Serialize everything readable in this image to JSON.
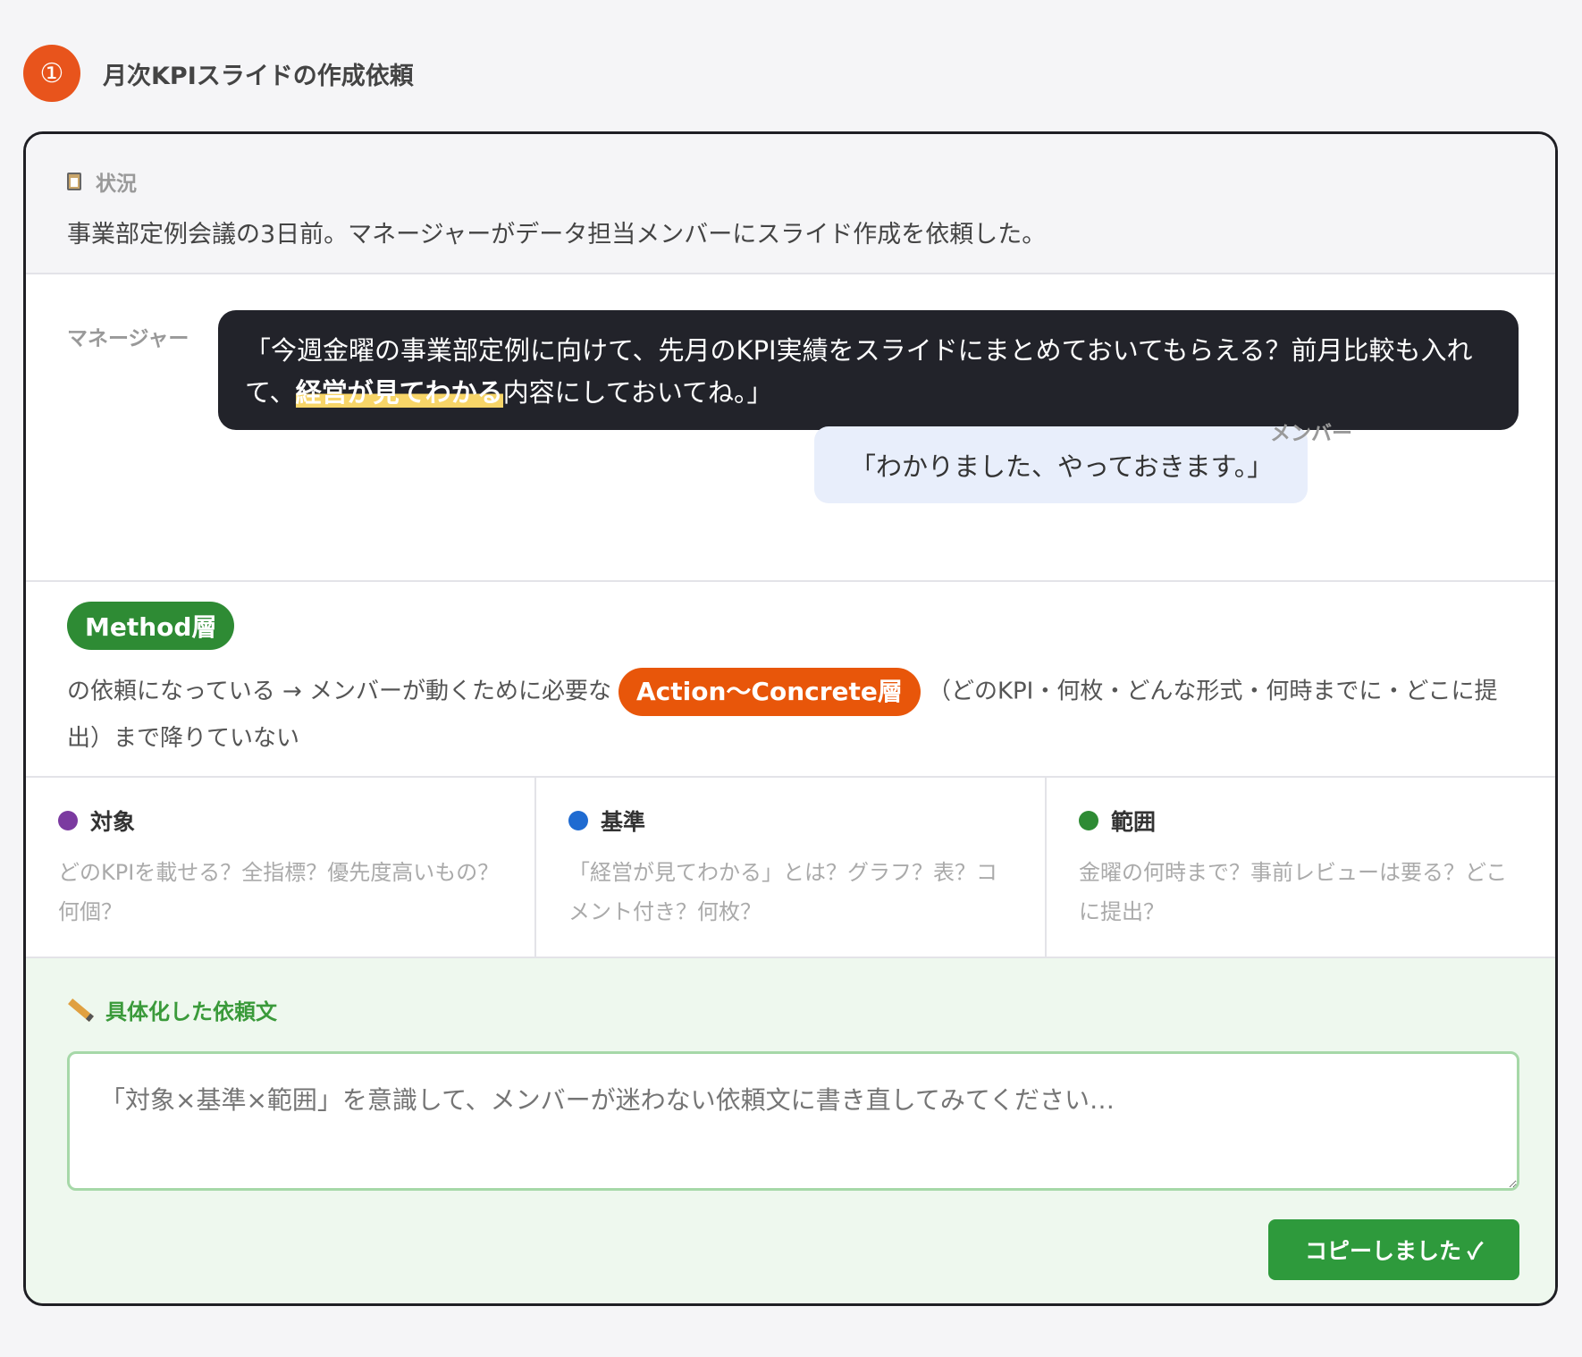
{
  "header": {
    "number": "①",
    "title": "月次KPIスライドの作成依頼"
  },
  "situation": {
    "label": "状況",
    "text": "事業部定例会議の3日前。マネージャーがデータ担当メンバーにスライド作成を依頼した。"
  },
  "conversation": {
    "manager_name": "マネージャー",
    "manager_text_1": "「今週金曜の事業部定例に向けて、先月のKPI実績をスライドにまとめておいてもらえる？前月比較も入れて、",
    "manager_highlight": "経営が見てわかる",
    "manager_text_2": "内容にしておいてね。」",
    "member_name": "メンバー",
    "member_text": "「わかりました、やっておきます。」"
  },
  "analysis": {
    "method_badge": "Method層",
    "text_1": "の依頼になっている → メンバーが動くために必要な",
    "action_badge": "Action〜Concrete層",
    "text_2": "（どのKPI・何枚・どんな形式・何時までに・どこに提出）まで降りていない"
  },
  "columns": [
    {
      "title": "対象",
      "color": "#7b3aa0",
      "question": "どのKPIを載せる？全指標？優先度高いもの？何個？"
    },
    {
      "title": "基準",
      "color": "#1f6bd1",
      "question": "「経営が見てわかる」とは？グラフ？表？コメント付き？何枚？"
    },
    {
      "title": "範囲",
      "color": "#2e8b34",
      "question": "金曜の何時まで？事前レビューは要る？どこに提出？"
    }
  ],
  "compose": {
    "label": "具体化した依頼文",
    "placeholder": "「対象×基準×範囲」を意識して、メンバーが迷わない依頼文に書き直してみてください…",
    "copy_button": "コピーしました ✓"
  }
}
